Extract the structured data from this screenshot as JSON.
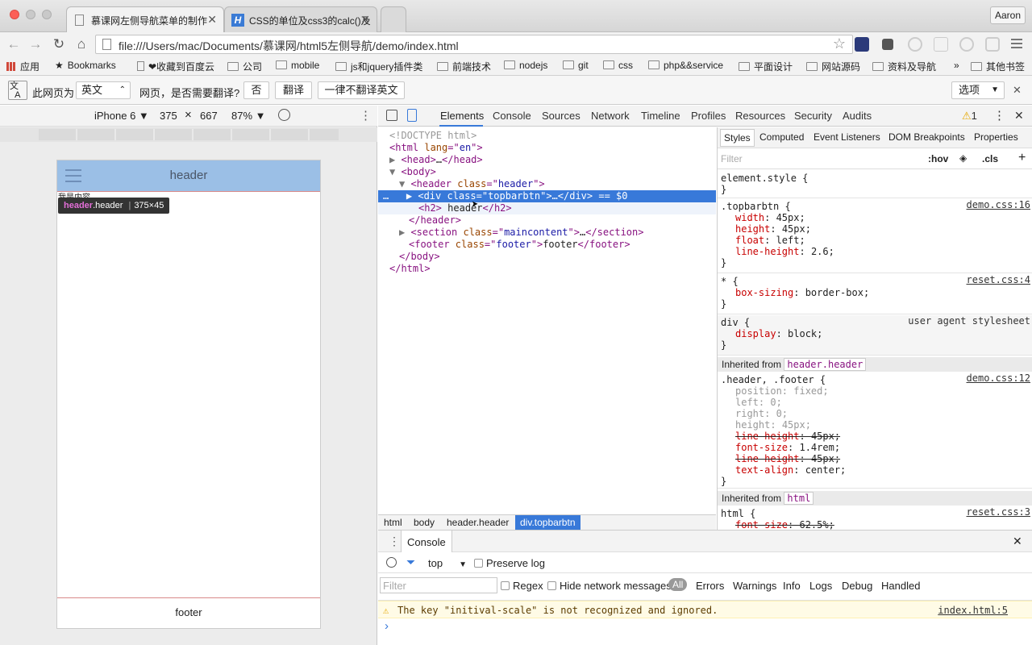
{
  "window": {
    "tabs": [
      {
        "label": "慕课网左侧导航菜单的制作",
        "active": true
      },
      {
        "label": "CSS的单位及css3的calc()及",
        "active": false
      }
    ],
    "profile": "Aaron"
  },
  "toolbar": {
    "url": "file:///Users/mac/Documents/慕课网/html5左侧导航/demo/index.html"
  },
  "bookmarks": {
    "items": [
      "应用",
      "Bookmarks",
      "❤收藏到百度云",
      "公司",
      "mobile",
      "js和jquery插件类",
      "前端技术",
      "nodejs",
      "git",
      "css",
      "php&&service",
      "平面设计",
      "网站源码",
      "资料及导航"
    ],
    "overflow": "»",
    "other": "其他书签"
  },
  "translate_bar": {
    "prefix": "此网页为",
    "language": "英文",
    "question": "网页，是否需要翻译?",
    "no": "否",
    "translate": "翻译",
    "never": "一律不翻译英文",
    "options": "选项"
  },
  "device": {
    "model": "iPhone 6 ▼",
    "width": "375",
    "times": "×",
    "height": "667",
    "zoom": "87% ▼"
  },
  "page": {
    "header": "header",
    "content": "我是内容",
    "footer": "footer",
    "tooltip_tag": "header",
    "tooltip_class": ".header",
    "tooltip_size": "375×45"
  },
  "devtools": {
    "tabs": [
      "Elements",
      "Console",
      "Sources",
      "Network",
      "Timeline",
      "Profiles",
      "Resources",
      "Security",
      "Audits"
    ],
    "warning_count": "1",
    "breadcrumbs": [
      "html",
      "body",
      "header.header",
      "div.topbarbtn"
    ],
    "styles_tabs": [
      "Styles",
      "Computed",
      "Event Listeners",
      "DOM Breakpoints",
      "Properties"
    ],
    "filter_placeholder": "Filter",
    "hov": ":hov",
    "cls": ".cls",
    "plus": "+",
    "inherited_label": "Inherited from",
    "inherited_header": "header.header",
    "inherited_html": "html",
    "dom": {
      "doctype": "<!DOCTYPE html>",
      "html_lang": "en",
      "header_class": "header",
      "div_class": "topbarbtn",
      "selected_suffix": "== $0",
      "h2_text": "header",
      "section_class": "maincontent",
      "footer_class": "footer",
      "footer_text": "footer"
    },
    "rules": {
      "element_style": "element.style {",
      "topbarbtn_selector": ".topbarbtn {",
      "topbarbtn_source": "demo.css:16",
      "topbarbtn_props": [
        {
          "name": "width",
          "value": "45px;"
        },
        {
          "name": "height",
          "value": "45px;"
        },
        {
          "name": "float",
          "value": "left;"
        },
        {
          "name": "line-height",
          "value": "2.6;"
        }
      ],
      "star_selector": "* {",
      "star_source": "reset.css:4",
      "star_props": [
        {
          "name": "box-sizing",
          "value": "border-box;"
        }
      ],
      "div_selector": "div {",
      "div_source": "user agent stylesheet",
      "div_props": [
        {
          "name": "display",
          "value": "block;"
        }
      ],
      "header_selector": ".header, .footer {",
      "header_source": "demo.css:12",
      "header_props": [
        {
          "name": "position",
          "value": "fixed;"
        },
        {
          "name": "left",
          "value": "0;"
        },
        {
          "name": "right",
          "value": "0;"
        },
        {
          "name": "height",
          "value": "45px;"
        },
        {
          "name": "line-height",
          "value": "45px;"
        },
        {
          "name": "font-size",
          "value": "1.4rem;"
        },
        {
          "name": "line-height",
          "value": "45px;"
        },
        {
          "name": "text-align",
          "value": "center;"
        }
      ],
      "html_selector": "html {",
      "html_source": "reset.css:3",
      "html_props": [
        {
          "name": "font-size",
          "value": "62.5%;"
        }
      ]
    },
    "console": {
      "tab": "Console",
      "context": "top",
      "preserve_log": "Preserve log",
      "filter_placeholder": "Filter",
      "regex": "Regex",
      "hide_network": "Hide network messages",
      "levels": [
        "All",
        "Errors",
        "Warnings",
        "Info",
        "Logs",
        "Debug",
        "Handled"
      ],
      "warning_message": "The key \"initival-scale\" is not recognized and ignored.",
      "warning_source": "index.html:5",
      "prompt": "›"
    }
  },
  "colors": {
    "accent": "#3879d9",
    "phone_header": "#9bbfe6",
    "tag": "#881280",
    "css_prop": "#c80000"
  }
}
